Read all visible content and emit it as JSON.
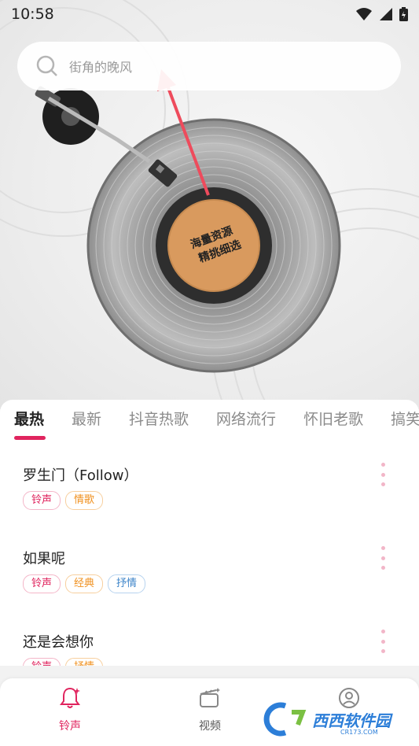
{
  "status_bar": {
    "time": "10:58"
  },
  "search": {
    "placeholder": "街角的晚风"
  },
  "hero": {
    "label_line1": "海量资源",
    "label_line2": "精挑细选"
  },
  "tabs": [
    {
      "label": "最热",
      "active": true
    },
    {
      "label": "最新"
    },
    {
      "label": "抖音热歌"
    },
    {
      "label": "网络流行"
    },
    {
      "label": "怀旧老歌"
    },
    {
      "label": "搞笑"
    }
  ],
  "songs": [
    {
      "title": "罗生门（Follow）",
      "tags": [
        {
          "text": "铃声",
          "color": "pink"
        },
        {
          "text": "情歌",
          "color": "orange"
        }
      ]
    },
    {
      "title": "如果呢",
      "tags": [
        {
          "text": "铃声",
          "color": "pink"
        },
        {
          "text": "经典",
          "color": "orange"
        },
        {
          "text": "抒情",
          "color": "blue"
        }
      ]
    },
    {
      "title": "还是会想你",
      "tags": [
        {
          "text": "铃声",
          "color": "pink"
        },
        {
          "text": "抒情",
          "color": "orange"
        }
      ]
    }
  ],
  "bottom_nav": [
    {
      "label": "铃声",
      "icon": "bell-icon",
      "active": true
    },
    {
      "label": "视频",
      "icon": "video-clapper-icon"
    },
    {
      "label": "",
      "icon": "user-icon"
    }
  ],
  "watermark": {
    "text": "西西软件园",
    "sub": "CR173.COM"
  },
  "colors": {
    "accent": "#e0245e",
    "tag_orange": "#f0901e",
    "tag_blue": "#3d84c9",
    "record_label": "#d99a5e"
  }
}
